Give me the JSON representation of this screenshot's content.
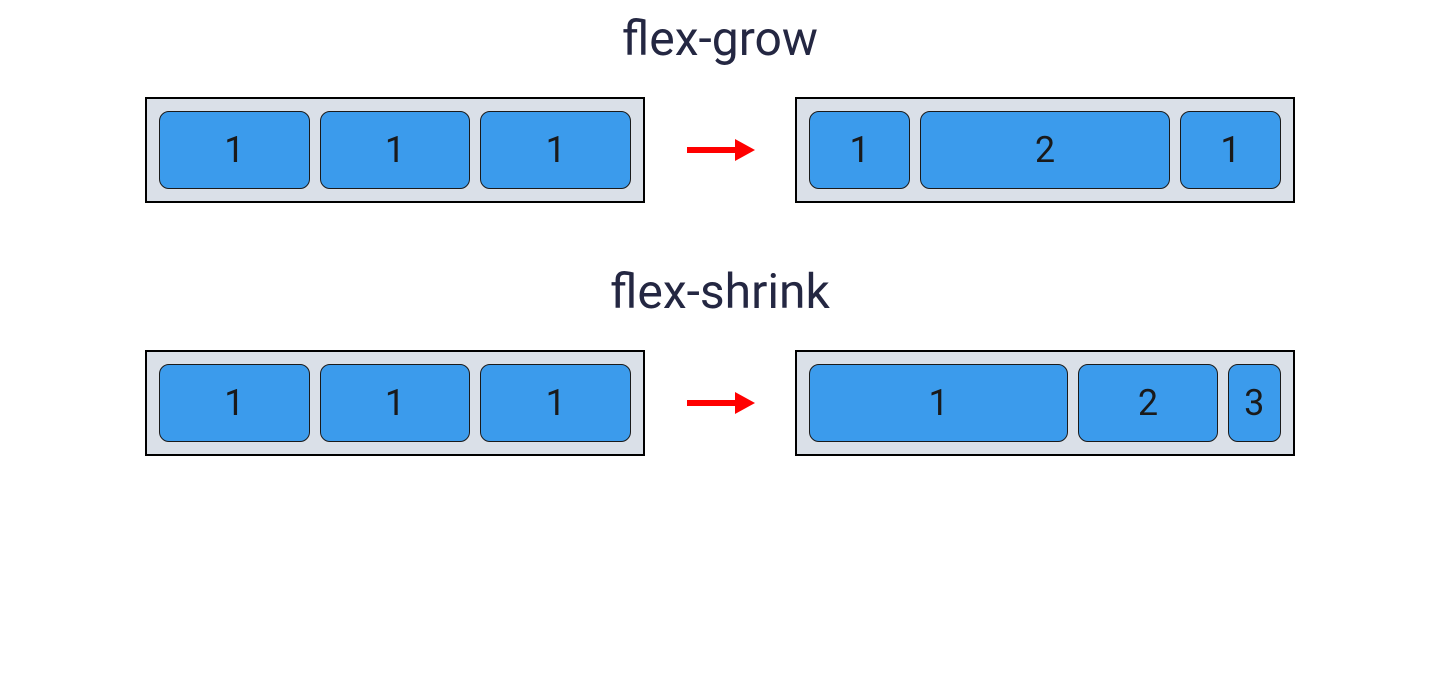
{
  "sections": {
    "grow": {
      "title": "flex-grow",
      "before": [
        "1",
        "1",
        "1"
      ],
      "after": [
        "1",
        "2",
        "1"
      ]
    },
    "shrink": {
      "title": "flex-shrink",
      "before": [
        "1",
        "1",
        "1"
      ],
      "after": [
        "1",
        "2",
        "3"
      ]
    }
  },
  "colors": {
    "item_fill": "#3b9bec",
    "container_fill": "#dae0e8",
    "arrow": "#ff0000",
    "title": "#242742"
  }
}
